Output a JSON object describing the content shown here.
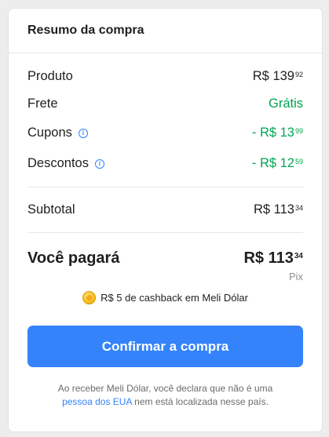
{
  "summary": {
    "title": "Resumo da compra",
    "rows": {
      "produto": {
        "label": "Produto",
        "value_main": "R$ 139",
        "value_cents": "92"
      },
      "frete": {
        "label": "Frete",
        "value": "Grátis"
      },
      "cupons": {
        "label": "Cupons",
        "value_main": "- R$ 13",
        "value_cents": "99"
      },
      "descontos": {
        "label": "Descontos",
        "value_main": "- R$ 12",
        "value_cents": "59"
      },
      "subtotal": {
        "label": "Subtotal",
        "value_main": "R$ 113",
        "value_cents": "34"
      }
    },
    "total": {
      "label": "Você pagará",
      "value_main": "R$ 113",
      "value_cents": "34",
      "method": "Pix"
    },
    "cashback": {
      "text": "R$ 5 de cashback em Meli Dólar"
    },
    "confirm_button": "Confirmar a compra",
    "disclaimer": {
      "part1": "Ao receber Meli Dólar, você declara que não é uma",
      "link": "pessoa dos EUA",
      "part2": "nem está localizada nesse país."
    }
  },
  "colors": {
    "accent": "#3483fa",
    "green": "#00a650",
    "coin": "#f7c325"
  },
  "icons": [
    "info-icon",
    "coin-icon"
  ]
}
